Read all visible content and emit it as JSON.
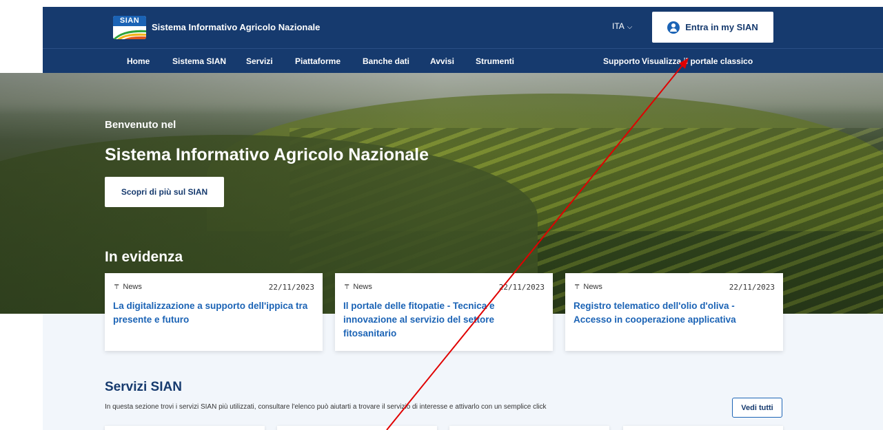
{
  "header": {
    "logo_text": "SIAN",
    "site_name": "Sistema Informativo Agricolo Nazionale",
    "language": "ITA",
    "login_label": "Entra in my SIAN"
  },
  "nav": {
    "items": [
      {
        "label": "Home"
      },
      {
        "label": "Sistema SIAN"
      },
      {
        "label": "Servizi"
      },
      {
        "label": "Piattaforme"
      },
      {
        "label": "Banche dati"
      },
      {
        "label": "Avvisi"
      },
      {
        "label": "Strumenti"
      }
    ],
    "right_items": [
      {
        "label": "Supporto"
      },
      {
        "label": "Visualizza il portale classico"
      }
    ]
  },
  "hero": {
    "subtitle": "Benvenuto nel",
    "title": "Sistema Informativo Agricolo Nazionale",
    "cta_label": "Scopri di più sul SIAN"
  },
  "highlights": {
    "title": "In evidenza",
    "cards": [
      {
        "category": "News",
        "date": "22/11/2023",
        "title": "La digitalizzazione a supporto dell'ippica tra presente e futuro"
      },
      {
        "category": "News",
        "date": "22/11/2023",
        "title": "Il portale delle fitopatie - Tecnica e innovazione al servizio del settore fitosanitario"
      },
      {
        "category": "News",
        "date": "22/11/2023",
        "title": "Registro telematico dell'olio d'oliva - Accesso in cooperazione applicativa"
      }
    ]
  },
  "services": {
    "title": "Servizi SIAN",
    "description": "In questa sezione trovi i servizi SIAN più utilizzati, consultare l'elenco può aiutarti a trovare il servizio di interesse e attivarlo con un semplice click",
    "see_all_label": "Vedi tutti"
  },
  "colors": {
    "primary": "#163a6e",
    "link": "#1b63b5",
    "annotation_arrow": "#e00000"
  },
  "icons": {
    "pin": "pin-icon",
    "user": "user-icon",
    "chevron": "chevron-down-icon"
  }
}
